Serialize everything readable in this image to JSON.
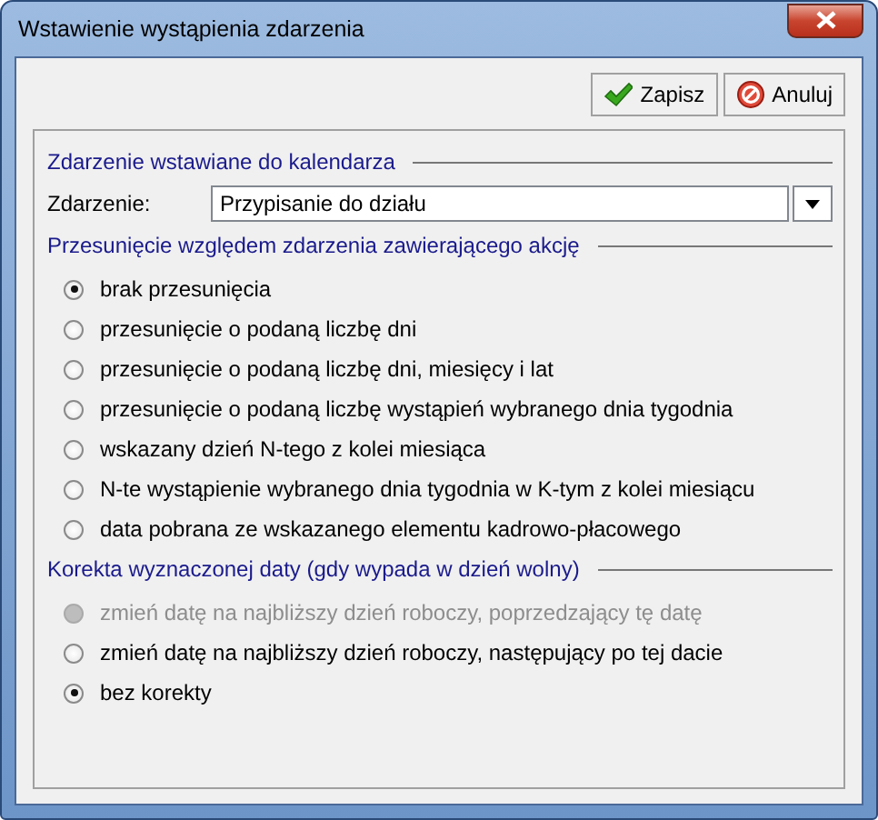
{
  "window": {
    "title": "Wstawienie wystąpienia zdarzenia"
  },
  "buttons": [
    {
      "label": "Zapisz",
      "kind": "save"
    },
    {
      "label": "Anuluj",
      "kind": "cancel"
    }
  ],
  "sections": [
    {
      "title": "Zdarzenie wstawiane do kalendarza",
      "kind": "field",
      "label": "Zdarzenie:",
      "value": "Przypisanie do działu"
    },
    {
      "title": "Przesunięcie względem zdarzenia zawierającego akcję",
      "kind": "radios",
      "options": [
        {
          "label": "brak przesunięcia",
          "selected": true,
          "disabled": false
        },
        {
          "label": "przesunięcie o podaną liczbę dni",
          "selected": false,
          "disabled": false
        },
        {
          "label": "przesunięcie o podaną liczbę dni, miesięcy i lat",
          "selected": false,
          "disabled": false
        },
        {
          "label": "przesunięcie o podaną liczbę wystąpień wybranego dnia tygodnia",
          "selected": false,
          "disabled": false
        },
        {
          "label": "wskazany dzień N-tego z kolei miesiąca",
          "selected": false,
          "disabled": false
        },
        {
          "label": "N-te wystąpienie wybranego dnia tygodnia w K-tym z kolei miesiącu",
          "selected": false,
          "disabled": false
        },
        {
          "label": "data pobrana ze wskazanego elementu kadrowo-płacowego",
          "selected": false,
          "disabled": false
        }
      ]
    },
    {
      "title": "Korekta wyznaczonej daty (gdy wypada w dzień wolny)",
      "kind": "radios",
      "options": [
        {
          "label": "zmień datę na najbliższy dzień roboczy, poprzedzający tę datę",
          "selected": false,
          "disabled": true
        },
        {
          "label": "zmień datę na najbliższy dzień roboczy, następujący po tej dacie",
          "selected": false,
          "disabled": false
        },
        {
          "label": "bez korekty",
          "selected": true,
          "disabled": false
        }
      ]
    }
  ]
}
